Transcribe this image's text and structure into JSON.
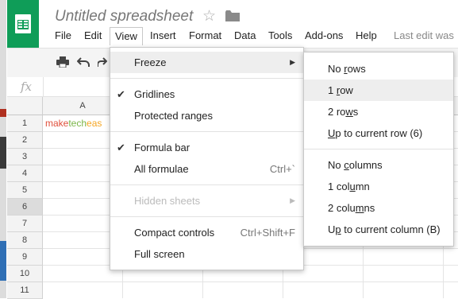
{
  "app": {
    "title": "Untitled spreadsheet",
    "last_edit": "Last edit was"
  },
  "menubar": [
    {
      "label": "File"
    },
    {
      "label": "Edit"
    },
    {
      "label": "View"
    },
    {
      "label": "Insert"
    },
    {
      "label": "Format"
    },
    {
      "label": "Data"
    },
    {
      "label": "Tools"
    },
    {
      "label": "Add-ons"
    },
    {
      "label": "Help"
    }
  ],
  "formula_bar": {
    "fx": "fx"
  },
  "sheet": {
    "columns": [
      "A"
    ],
    "rows": [
      "1",
      "2",
      "3",
      "4",
      "5",
      "6",
      "7",
      "8",
      "9",
      "10",
      "11"
    ],
    "cell_a1": {
      "part1": "make",
      "part2": "tech",
      "part3": "eas"
    }
  },
  "view_menu": {
    "freeze": "Freeze",
    "gridlines": "Gridlines",
    "protected_ranges": "Protected ranges",
    "formula_bar": "Formula bar",
    "all_formulae": "All formulae",
    "all_formulae_shortcut": "Ctrl+`",
    "hidden_sheets": "Hidden sheets",
    "compact_controls": "Compact controls",
    "compact_controls_shortcut": "Ctrl+Shift+F",
    "full_screen": "Full screen"
  },
  "freeze_menu": {
    "no_rows": {
      "pre": "No ",
      "u": "r",
      "post": "ows"
    },
    "one_row": {
      "pre": "1 ",
      "u": "r",
      "post": "ow"
    },
    "two_rows": {
      "pre": "2 ro",
      "u": "w",
      "post": "s"
    },
    "up_to_row": {
      "pre": "",
      "u": "U",
      "post": "p to current row (6)"
    },
    "no_columns": {
      "pre": "No ",
      "u": "c",
      "post": "olumns"
    },
    "one_column": {
      "pre": "1 col",
      "u": "u",
      "post": "mn"
    },
    "two_columns": {
      "pre": "2 colu",
      "u": "m",
      "post": "ns"
    },
    "up_to_column": {
      "pre": "U",
      "u": "p",
      "post": " to current column (B)"
    }
  },
  "colors": {
    "brand_green": "#0f9d58",
    "highlight": "#eeeeee"
  }
}
